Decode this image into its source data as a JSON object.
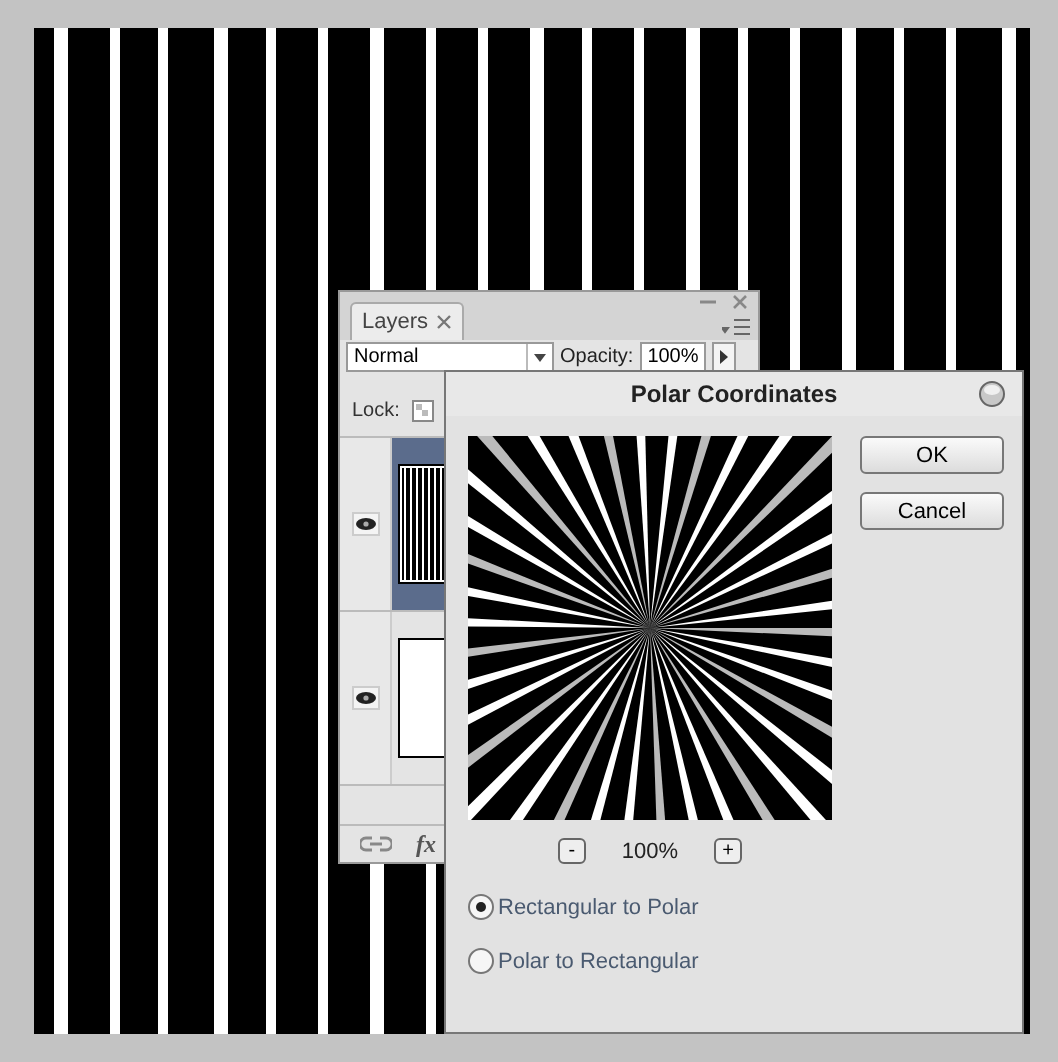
{
  "layers_panel": {
    "tab": {
      "label": "Layers",
      "selected": true
    },
    "blend_mode": {
      "value": "Normal"
    },
    "opacity": {
      "label": "Opacity:",
      "value": "100%"
    },
    "lock": {
      "label": "Lock:"
    },
    "layers": [
      {
        "kind": "stripes",
        "selected": true,
        "visible": true
      },
      {
        "kind": "blank",
        "selected": false,
        "visible": true
      }
    ],
    "footer": {
      "fx": "fx"
    }
  },
  "dialog": {
    "title": "Polar Coordinates",
    "zoom": {
      "minus": "-",
      "value": "100%",
      "plus": "+"
    },
    "buttons": [
      "OK",
      "Cancel"
    ],
    "options": [
      {
        "label": "Rectangular to Polar",
        "selected": true
      },
      {
        "label": "Polar to Rectangular",
        "selected": false
      }
    ]
  }
}
